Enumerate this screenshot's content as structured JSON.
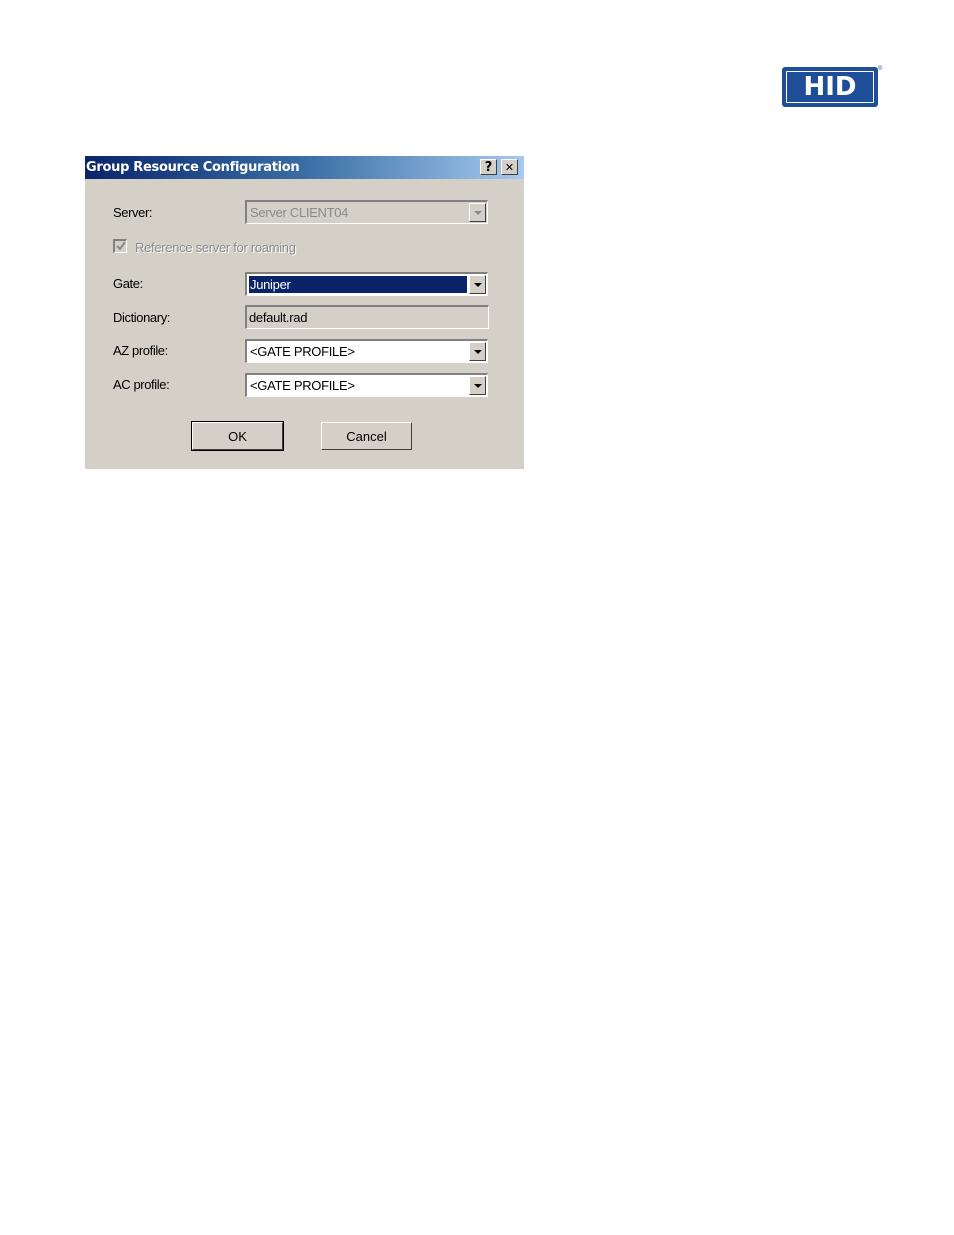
{
  "logo": {
    "text": "HID",
    "registered": "®"
  },
  "dialog": {
    "title": "Group Resource Configuration",
    "help_glyph": "?",
    "close_glyph": "✕",
    "server": {
      "label": "Server:",
      "value": "Server CLIENT04",
      "disabled": true
    },
    "reference_roaming": {
      "label": "Reference server for roaming",
      "checked": true,
      "disabled": true
    },
    "gate": {
      "label": "Gate:",
      "value": "Juniper"
    },
    "dictionary": {
      "label": "Dictionary:",
      "value": "default.rad"
    },
    "az_profile": {
      "label": "AZ profile:",
      "value": "<GATE PROFILE>"
    },
    "ac_profile": {
      "label": "AC profile:",
      "value": "<GATE PROFILE>"
    },
    "ok_label": "OK",
    "cancel_label": "Cancel"
  },
  "colors": {
    "brand": "#1f4e99",
    "title_gradient_start": "#0a246a",
    "title_gradient_end": "#a6caf0",
    "dialog_face": "#d4d0c8",
    "selection": "#0a246a"
  }
}
